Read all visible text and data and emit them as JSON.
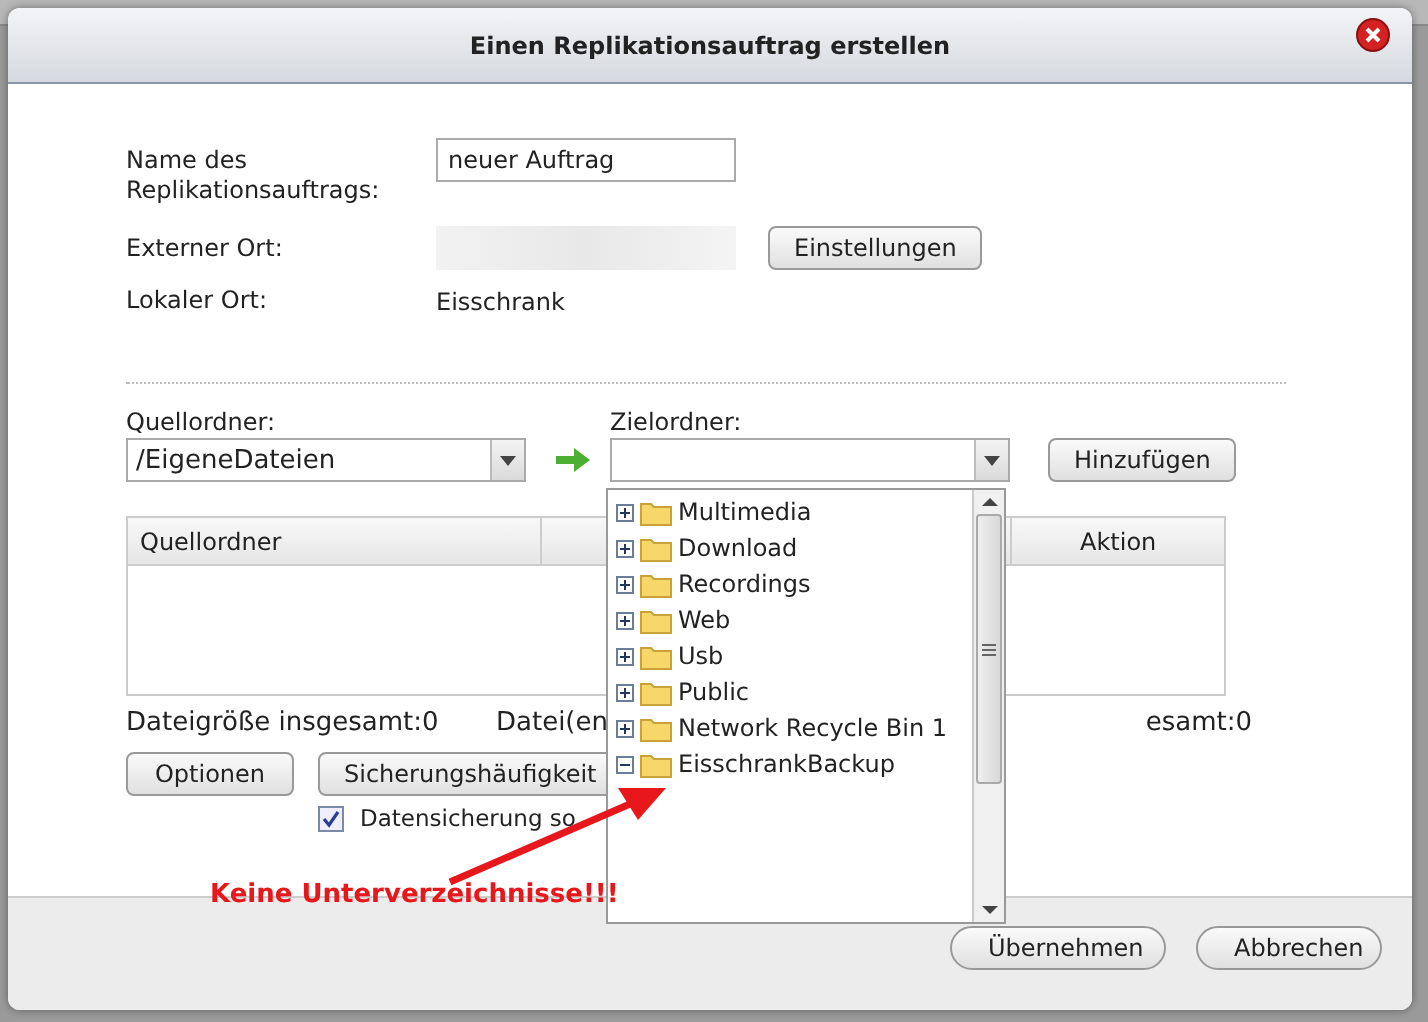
{
  "window": {
    "title": "Einen Replikationsauftrag erstellen"
  },
  "form": {
    "name_label": "Name des Replikationsauftrags:",
    "name_value": "neuer Auftrag",
    "external_label": "Externer Ort:",
    "settings_button": "Einstellungen",
    "local_label": "Lokaler Ort:",
    "local_value": "Eisschrank"
  },
  "source": {
    "label": "Quellordner:",
    "value": "/EigeneDateien"
  },
  "target": {
    "label": "Zielordner:",
    "add_button": "Hinzufügen"
  },
  "table": {
    "columns": [
      "Quellordner",
      "Aktion"
    ]
  },
  "stats": [
    "Dateigröße insgesamt:0",
    "Datei(en",
    "esamt:0"
  ],
  "options_button": "Optionen",
  "schedule_button": "Sicherungshäufigkeit",
  "backup_checkbox": {
    "label": "Datensicherung so",
    "checked": true
  },
  "folder_tree": [
    {
      "name": "Multimedia",
      "expanded": false
    },
    {
      "name": "Download",
      "expanded": false
    },
    {
      "name": "Recordings",
      "expanded": false
    },
    {
      "name": "Web",
      "expanded": false
    },
    {
      "name": "Usb",
      "expanded": false
    },
    {
      "name": "Public",
      "expanded": false
    },
    {
      "name": "Network Recycle Bin 1",
      "expanded": false
    },
    {
      "name": "EisschrankBackup",
      "expanded": true
    }
  ],
  "annotation": "Keine Unterverzeichnisse!!!",
  "footer_buttons": [
    "Übernehmen",
    "Abbrechen"
  ]
}
